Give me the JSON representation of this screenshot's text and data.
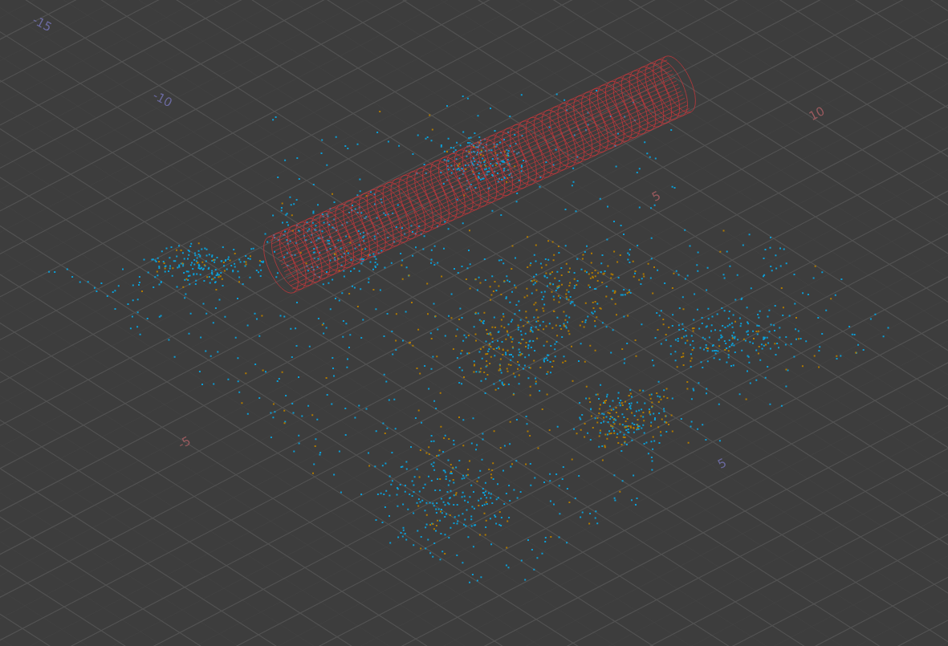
{
  "viewport": {
    "grid_labels": [
      {
        "text": "-15",
        "color": "#6b6aa0"
      },
      {
        "text": "-10",
        "color": "#6b6aa0"
      },
      {
        "text": "10",
        "color": "#9a5a5e"
      },
      {
        "text": "5",
        "color": "#9a5a5e"
      },
      {
        "text": "-5",
        "color": "#9a5a5e"
      },
      {
        "text": "5",
        "color": "#6b6aa0"
      }
    ]
  }
}
